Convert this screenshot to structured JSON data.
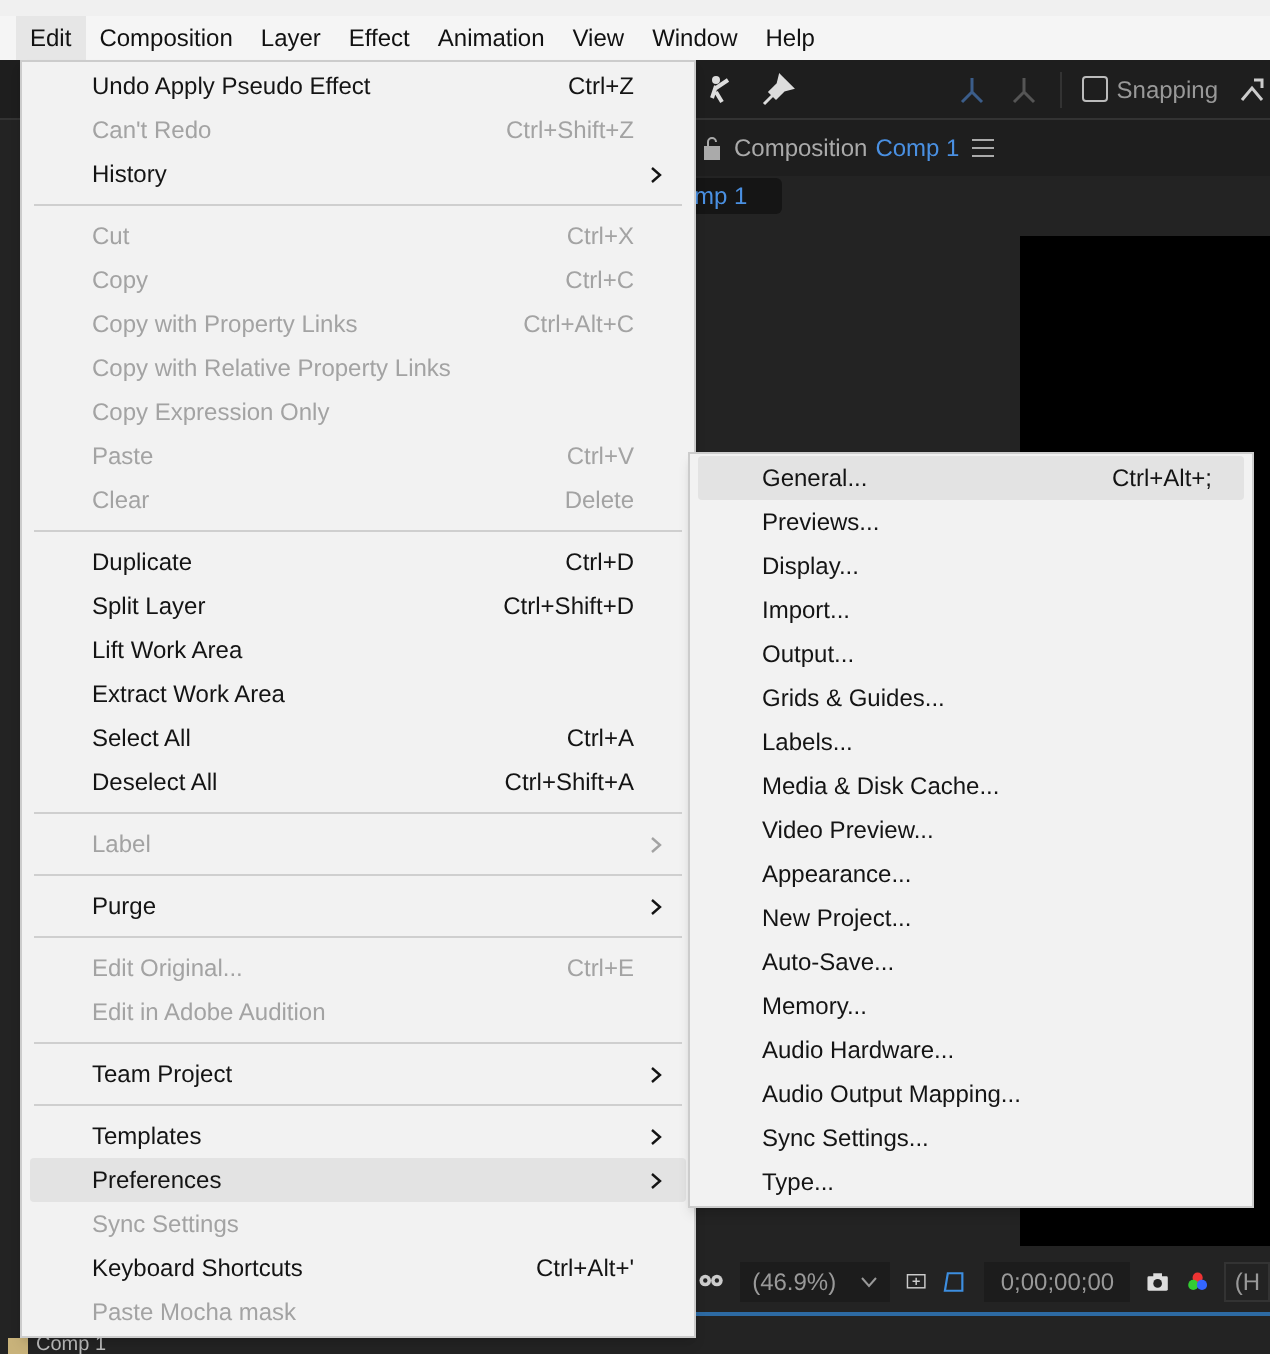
{
  "menu_bar": [
    {
      "label": "Edit",
      "selected": true
    },
    {
      "label": "Composition",
      "selected": false
    },
    {
      "label": "Layer",
      "selected": false
    },
    {
      "label": "Effect",
      "selected": false
    },
    {
      "label": "Animation",
      "selected": false
    },
    {
      "label": "View",
      "selected": false
    },
    {
      "label": "Window",
      "selected": false
    },
    {
      "label": "Help",
      "selected": false
    }
  ],
  "toolbar": {
    "snapping": {
      "label": "Snapping",
      "checked": false
    }
  },
  "composition_panel": {
    "title": "Composition",
    "comp_name": "Comp 1",
    "tab": "mp 1",
    "zoom": "(46.9%)",
    "timecode": "0;00;00;00",
    "resolution": "(H"
  },
  "timeline_tab": "Comp 1",
  "edit_menu": [
    {
      "kind": "item",
      "label": "Undo Apply Pseudo Effect",
      "shortcut": "Ctrl+Z",
      "disabled": false,
      "submenu": false,
      "selected": false
    },
    {
      "kind": "item",
      "label": "Can't Redo",
      "shortcut": "Ctrl+Shift+Z",
      "disabled": true,
      "submenu": false,
      "selected": false
    },
    {
      "kind": "item",
      "label": "History",
      "disabled": false,
      "submenu": true,
      "selected": false
    },
    {
      "kind": "separator"
    },
    {
      "kind": "item",
      "label": "Cut",
      "shortcut": "Ctrl+X",
      "disabled": true,
      "submenu": false,
      "selected": false
    },
    {
      "kind": "item",
      "label": "Copy",
      "shortcut": "Ctrl+C",
      "disabled": true,
      "submenu": false,
      "selected": false
    },
    {
      "kind": "item",
      "label": "Copy with Property Links",
      "shortcut": "Ctrl+Alt+C",
      "disabled": true,
      "submenu": false,
      "selected": false
    },
    {
      "kind": "item",
      "label": "Copy with Relative Property Links",
      "disabled": true,
      "submenu": false,
      "selected": false
    },
    {
      "kind": "item",
      "label": "Copy Expression Only",
      "disabled": true,
      "submenu": false,
      "selected": false
    },
    {
      "kind": "item",
      "label": "Paste",
      "shortcut": "Ctrl+V",
      "disabled": true,
      "submenu": false,
      "selected": false
    },
    {
      "kind": "item",
      "label": "Clear",
      "shortcut": "Delete",
      "disabled": true,
      "submenu": false,
      "selected": false
    },
    {
      "kind": "separator"
    },
    {
      "kind": "item",
      "label": "Duplicate",
      "shortcut": "Ctrl+D",
      "disabled": false,
      "submenu": false,
      "selected": false
    },
    {
      "kind": "item",
      "label": "Split Layer",
      "shortcut": "Ctrl+Shift+D",
      "disabled": false,
      "submenu": false,
      "selected": false
    },
    {
      "kind": "item",
      "label": "Lift Work Area",
      "disabled": false,
      "submenu": false,
      "selected": false
    },
    {
      "kind": "item",
      "label": "Extract Work Area",
      "disabled": false,
      "submenu": false,
      "selected": false
    },
    {
      "kind": "item",
      "label": "Select All",
      "shortcut": "Ctrl+A",
      "disabled": false,
      "submenu": false,
      "selected": false
    },
    {
      "kind": "item",
      "label": "Deselect All",
      "shortcut": "Ctrl+Shift+A",
      "disabled": false,
      "submenu": false,
      "selected": false
    },
    {
      "kind": "separator"
    },
    {
      "kind": "item",
      "label": "Label",
      "disabled": true,
      "submenu": true,
      "selected": false
    },
    {
      "kind": "separator"
    },
    {
      "kind": "item",
      "label": "Purge",
      "disabled": false,
      "submenu": true,
      "selected": false
    },
    {
      "kind": "separator"
    },
    {
      "kind": "item",
      "label": "Edit Original...",
      "shortcut": "Ctrl+E",
      "disabled": true,
      "submenu": false,
      "selected": false
    },
    {
      "kind": "item",
      "label": "Edit in Adobe Audition",
      "disabled": true,
      "submenu": false,
      "selected": false
    },
    {
      "kind": "separator"
    },
    {
      "kind": "item",
      "label": "Team Project",
      "disabled": false,
      "submenu": true,
      "selected": false
    },
    {
      "kind": "separator"
    },
    {
      "kind": "item",
      "label": "Templates",
      "disabled": false,
      "submenu": true,
      "selected": false
    },
    {
      "kind": "item",
      "label": "Preferences",
      "disabled": false,
      "submenu": true,
      "selected": true
    },
    {
      "kind": "item",
      "label": "Sync Settings",
      "disabled": true,
      "submenu": false,
      "selected": false
    },
    {
      "kind": "item",
      "label": "Keyboard Shortcuts",
      "shortcut": "Ctrl+Alt+'",
      "disabled": false,
      "submenu": false,
      "selected": false
    },
    {
      "kind": "item",
      "label": "Paste Mocha mask",
      "disabled": true,
      "submenu": false,
      "selected": false
    }
  ],
  "preferences_submenu": [
    {
      "label": "General...",
      "shortcut": "Ctrl+Alt+;",
      "selected": true
    },
    {
      "label": "Previews...",
      "selected": false
    },
    {
      "label": "Display...",
      "selected": false
    },
    {
      "label": "Import...",
      "selected": false
    },
    {
      "label": "Output...",
      "selected": false
    },
    {
      "label": "Grids & Guides...",
      "selected": false
    },
    {
      "label": "Labels...",
      "selected": false
    },
    {
      "label": "Media & Disk Cache...",
      "selected": false
    },
    {
      "label": "Video Preview...",
      "selected": false
    },
    {
      "label": "Appearance...",
      "selected": false
    },
    {
      "label": "New Project...",
      "selected": false
    },
    {
      "label": "Auto-Save...",
      "selected": false
    },
    {
      "label": "Memory...",
      "selected": false
    },
    {
      "label": "Audio Hardware...",
      "selected": false
    },
    {
      "label": "Audio Output Mapping...",
      "selected": false
    },
    {
      "label": "Sync Settings...",
      "selected": false
    },
    {
      "label": "Type...",
      "selected": false
    }
  ]
}
